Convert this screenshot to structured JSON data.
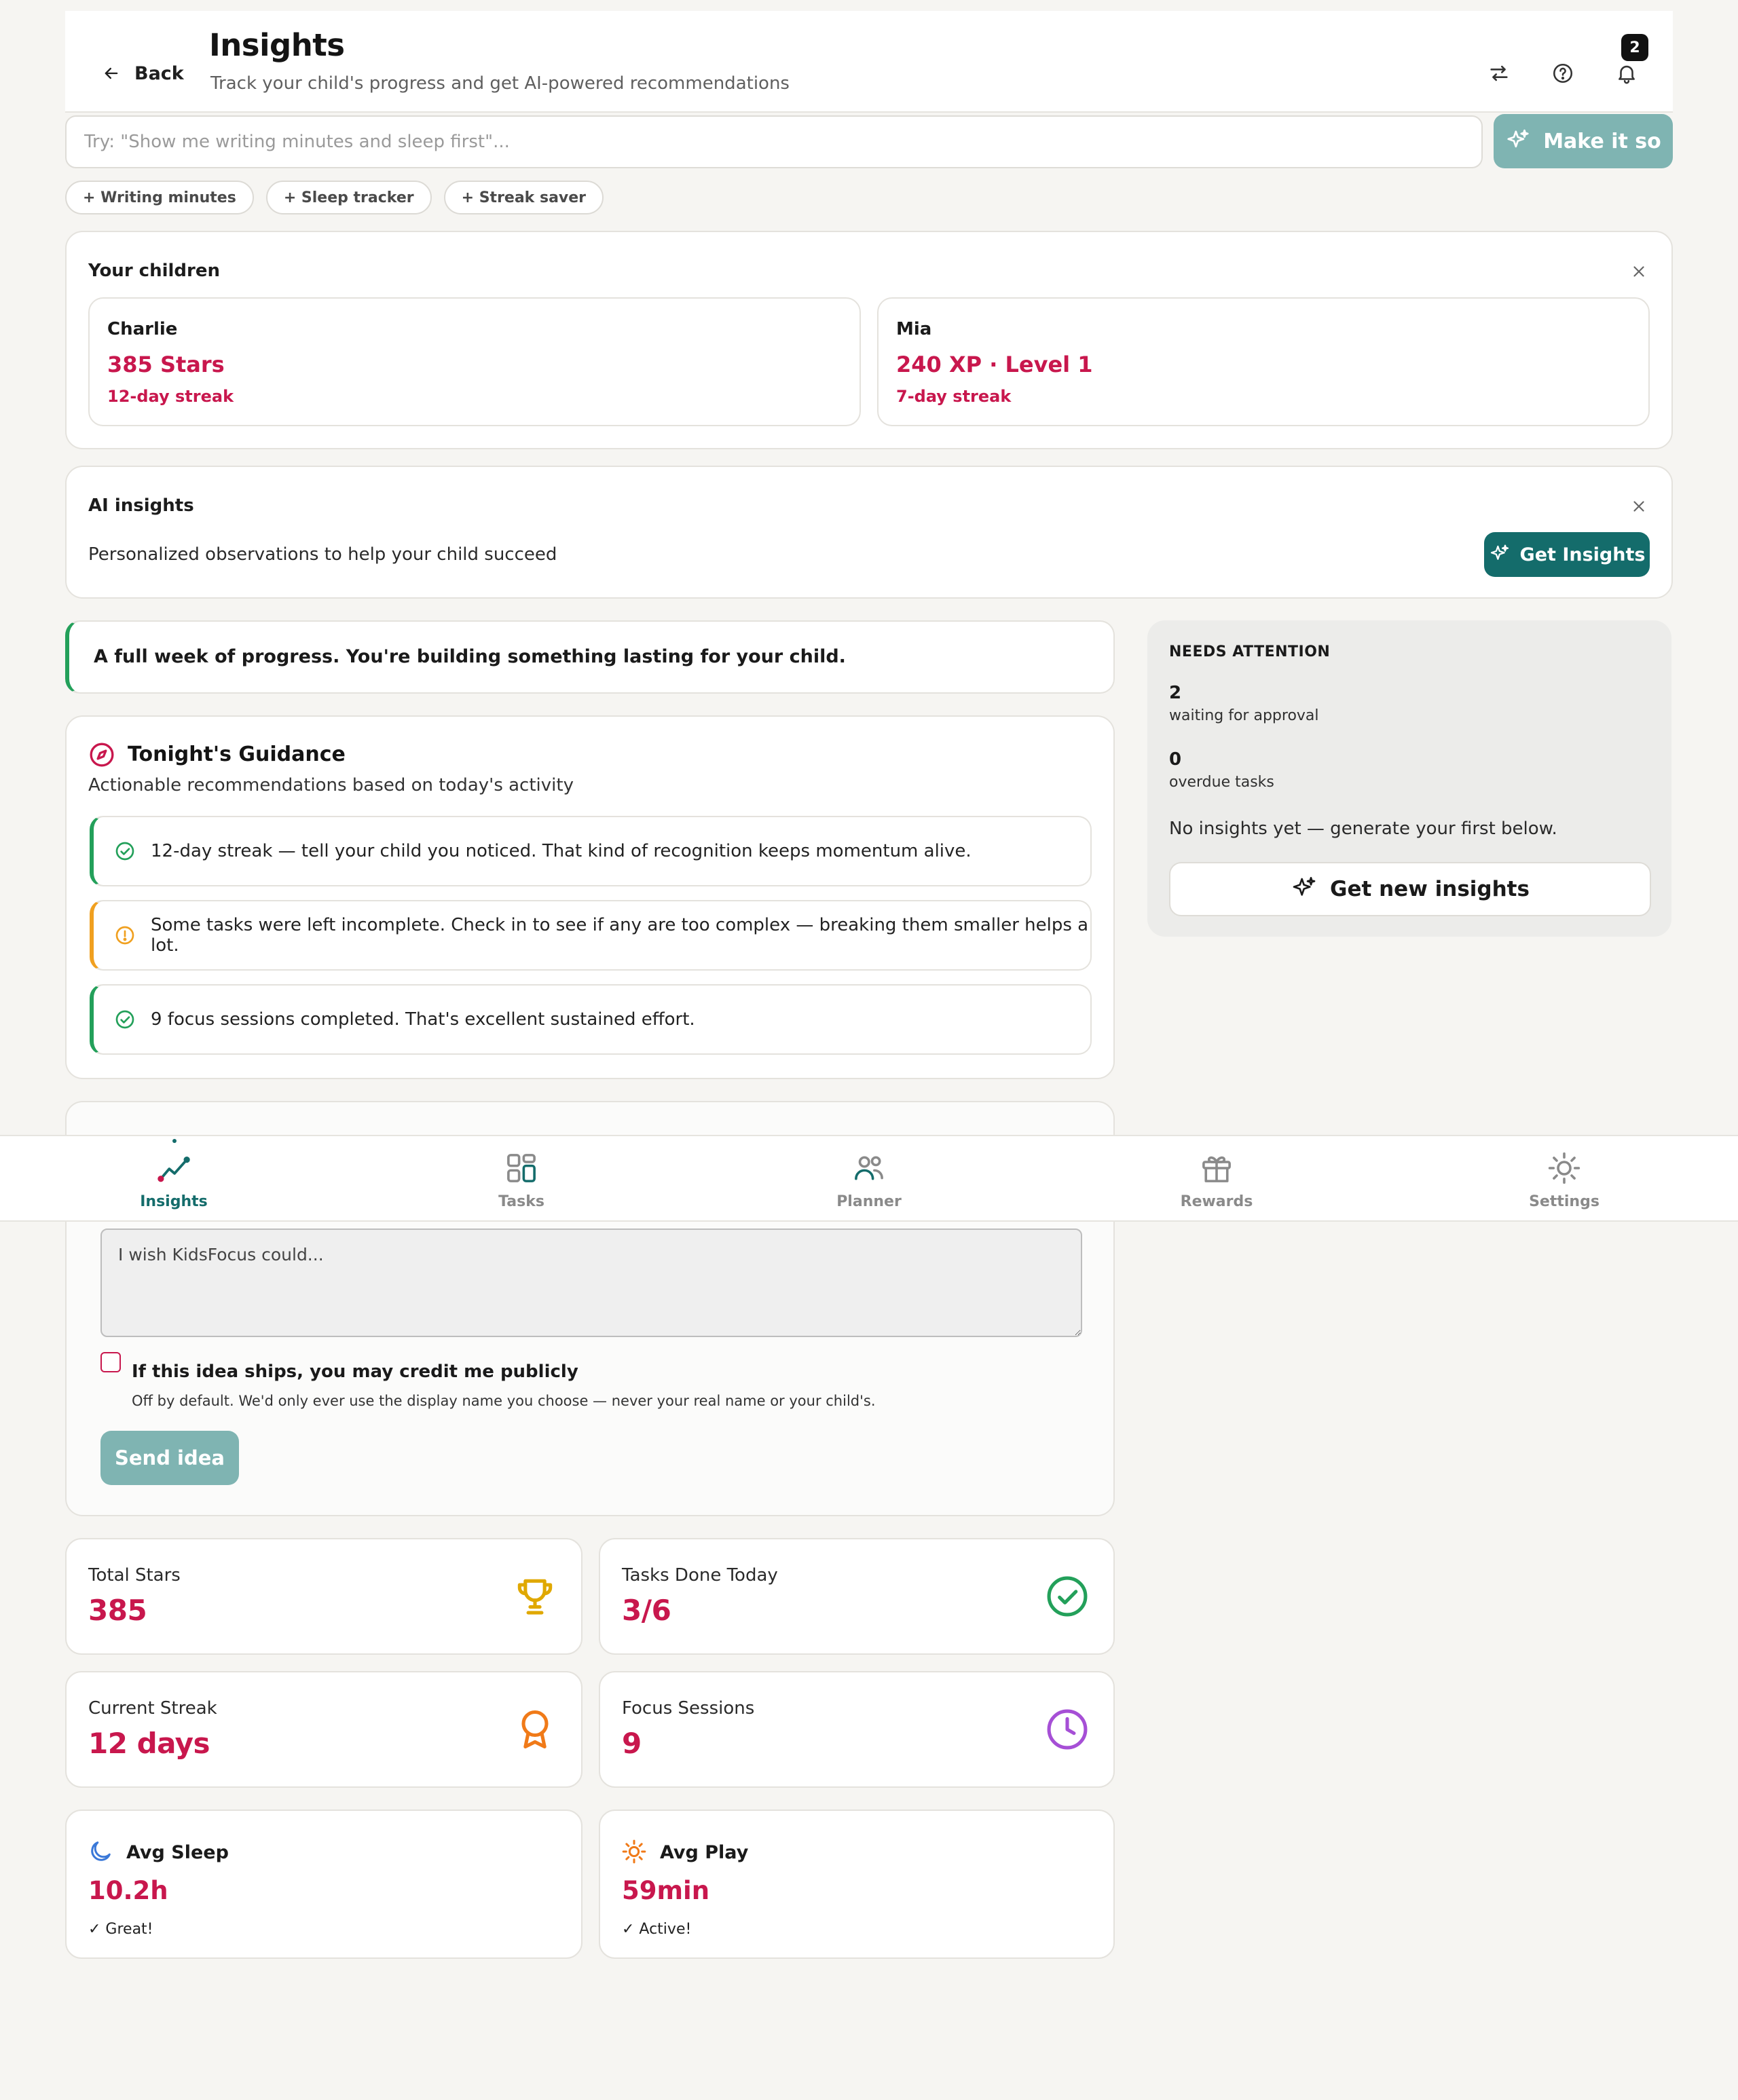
{
  "header": {
    "back_label": "Back",
    "title": "Insights",
    "subtitle": "Track your child's progress and get AI-powered recommendations",
    "notifications_count": "2"
  },
  "command": {
    "placeholder": "Try: \"Show me writing minutes and sleep first\"...",
    "button_label": "Make it so",
    "chips": [
      "+ Writing minutes",
      "+ Sleep tracker",
      "+ Streak saver"
    ]
  },
  "children": {
    "title": "Your children",
    "list": [
      {
        "name": "Charlie",
        "score": "385 Stars",
        "streak": "12-day streak"
      },
      {
        "name": "Mia",
        "score": "240 XP · Level 1",
        "streak": "7-day streak"
      }
    ]
  },
  "ai_insights": {
    "title": "AI insights",
    "description": "Personalized observations to help your child succeed",
    "button_label": "Get Insights"
  },
  "banner": {
    "text": "A full week of progress. You're building something lasting for your child."
  },
  "attention": {
    "heading": "NEEDS ATTENTION",
    "approval_count": "2",
    "approval_label": "waiting for approval",
    "overdue_count": "0",
    "overdue_label": "overdue tasks",
    "empty_text": "No insights yet — generate your first below.",
    "button_label": "Get new insights"
  },
  "guidance": {
    "title": "Tonight's Guidance",
    "subtitle": "Actionable recommendations based on today's activity",
    "items": [
      {
        "tone": "success",
        "text": "12-day streak — tell your child you noticed. That kind of recognition keeps momentum alive."
      },
      {
        "tone": "warning",
        "text": "Some tasks were left incomplete. Check in to see if any are too complex — breaking them smaller helps a lot."
      },
      {
        "tone": "success",
        "text": "9 focus sessions completed. That's excellent sustained effort."
      }
    ]
  },
  "nav": {
    "items": [
      {
        "label": "Insights",
        "active": true
      },
      {
        "label": "Tasks",
        "active": false
      },
      {
        "label": "Planner",
        "active": false
      },
      {
        "label": "Rewards",
        "active": false
      },
      {
        "label": "Settings",
        "active": false
      }
    ]
  },
  "idea": {
    "placeholder": "I wish KidsFocus could...",
    "credit_label": "If this idea ships, you may credit me publicly",
    "credit_help": "Off by default. We'd only ever use the display name you choose — never your real name or your child's.",
    "send_label": "Send idea"
  },
  "stats": {
    "total_stars": {
      "label": "Total Stars",
      "value": "385"
    },
    "tasks_today": {
      "label": "Tasks Done Today",
      "value": "3/6"
    },
    "streak": {
      "label": "Current Streak",
      "value": "12 days"
    },
    "focus": {
      "label": "Focus Sessions",
      "value": "9"
    },
    "sleep": {
      "label": "Avg Sleep",
      "value": "10.2h",
      "note": "✓ Great!"
    },
    "play": {
      "label": "Avg Play",
      "value": "59min",
      "note": "✓ Active!"
    }
  },
  "colors": {
    "accent_teal": "#146c6b",
    "accent_teal_light": "#7fb4b2",
    "score_pink": "#c8174d",
    "success_green": "#23a05a",
    "warning_amber": "#f0a020"
  }
}
